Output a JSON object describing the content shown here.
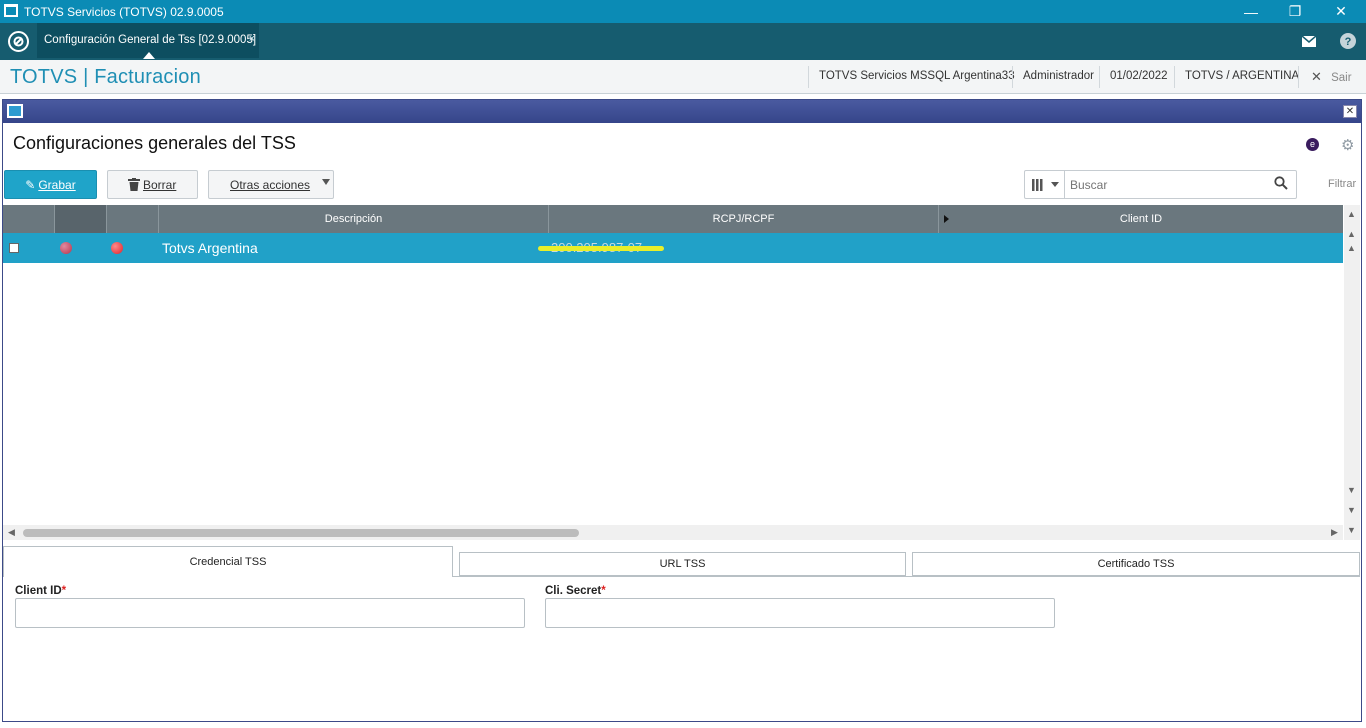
{
  "window": {
    "title": "TOTVS Servicios (TOTVS) 02.9.0005",
    "minimize": "—",
    "restore": "❐",
    "close": "✕"
  },
  "tabs": {
    "active_tab": "Configuración General de Tss [02.9.0005]",
    "close_glyph": "×"
  },
  "header": {
    "brand": "TOTVS | Facturacion",
    "environment": "TOTVS Servicios MSSQL Argentina33",
    "user": "Administrador",
    "date": "01/02/2022",
    "company": "TOTVS / ARGENTINA",
    "exit_label": "Sair"
  },
  "page": {
    "title": "Configuraciones generales del TSS",
    "badge": "e"
  },
  "toolbar": {
    "save_label": "Grabar",
    "delete_label": "Borrar",
    "more_label": "Otras acciones",
    "search_placeholder": "Buscar",
    "filter_label": "Filtrar"
  },
  "grid": {
    "columns": [
      "Descripción",
      "RCPJ/RCPF",
      "Client ID"
    ],
    "rows": [
      {
        "status_color_1": "#b8324a",
        "status_color_2": "#e0202a",
        "descripcion": "Totvs Argentina",
        "rcpj": "200.205.987-07",
        "client_id": ""
      }
    ]
  },
  "form": {
    "tabs": [
      "Credencial TSS",
      "URL TSS",
      "Certificado TSS"
    ],
    "active_tab": "Credencial TSS",
    "client_id_label": "Client ID",
    "client_secret_label": "Cli. Secret",
    "required_mark": "*",
    "client_id_value": "",
    "client_secret_value": ""
  },
  "colors": {
    "accent": "#1fa4c9",
    "header_grid": "#6a777e",
    "selected_row": "#21a1c8",
    "title_bar": "#0b8bb5"
  }
}
